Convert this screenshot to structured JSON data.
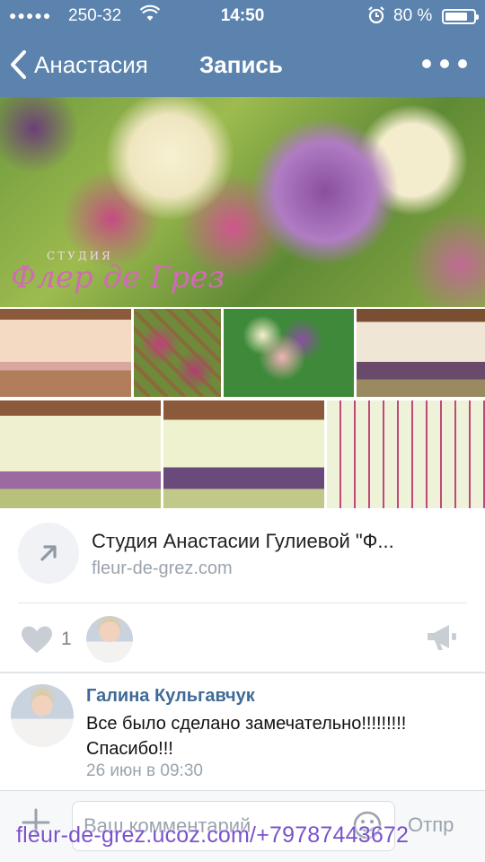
{
  "status_bar": {
    "signal": "●●●●●",
    "carrier": "250-32",
    "time": "14:50",
    "battery_text": "80 %",
    "battery_level": 0.8
  },
  "nav": {
    "back_label": "Анастасия",
    "title": "Запись"
  },
  "hero_logo": {
    "line1": "СТУДИЯ",
    "line2": "Флер де Грез"
  },
  "link_card": {
    "title": "Студия Анастасии Гулиевой \"Ф...",
    "url": "fleur-de-grez.com"
  },
  "likes": {
    "count": "1"
  },
  "comment": {
    "author": "Галина Кульгавчук",
    "text": "Все было сделано замечательно!!!!!!!!! Спасибо!!!",
    "time": "26 июн в 09:30"
  },
  "input": {
    "placeholder": "Ваш комментарий",
    "send_label": "Отпр"
  },
  "watermark": "fleur-de-grez.ucoz.com/+79787443672",
  "colors": {
    "header": "#5b83ad",
    "author": "#3f6a97",
    "muted": "#9aa3ad",
    "watermark": "#7b52c9"
  }
}
